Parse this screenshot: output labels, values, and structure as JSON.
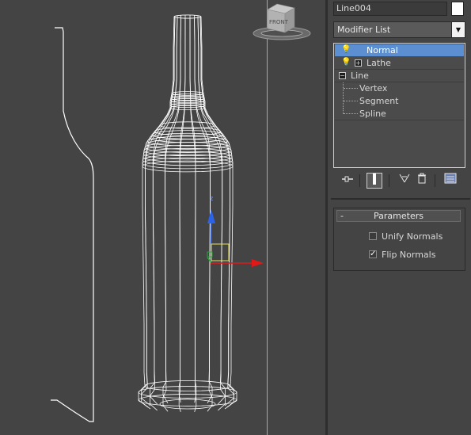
{
  "viewport": {
    "viewcube_label": "FRONT",
    "axis_colors": {
      "x": "#e01818",
      "y": "#2a62e8",
      "z": "#22a83a"
    },
    "divider_color": "#c9b800"
  },
  "panel": {
    "object_name": "Line004",
    "color_swatch": "#ffffff",
    "modifier_list": {
      "label": "Modifier List"
    },
    "stack": {
      "items": [
        {
          "label": "Normal",
          "selected": true
        },
        {
          "label": "Lathe"
        },
        {
          "label": "Line"
        },
        {
          "label": "Vertex"
        },
        {
          "label": "Segment"
        },
        {
          "label": "Spline"
        }
      ]
    },
    "toolbar_icons": [
      "pin-stack-icon",
      "show-end-result-icon",
      "make-unique-icon",
      "remove-modifier-icon",
      "configure-sets-icon"
    ],
    "parameters": {
      "collapse_symbol": "-",
      "title": "Parameters",
      "unify_normals": {
        "label": "Unify Normals",
        "checked": false,
        "check_mark": ""
      },
      "flip_normals": {
        "label": "Flip Normals",
        "checked": true,
        "check_mark": "✓"
      }
    }
  }
}
